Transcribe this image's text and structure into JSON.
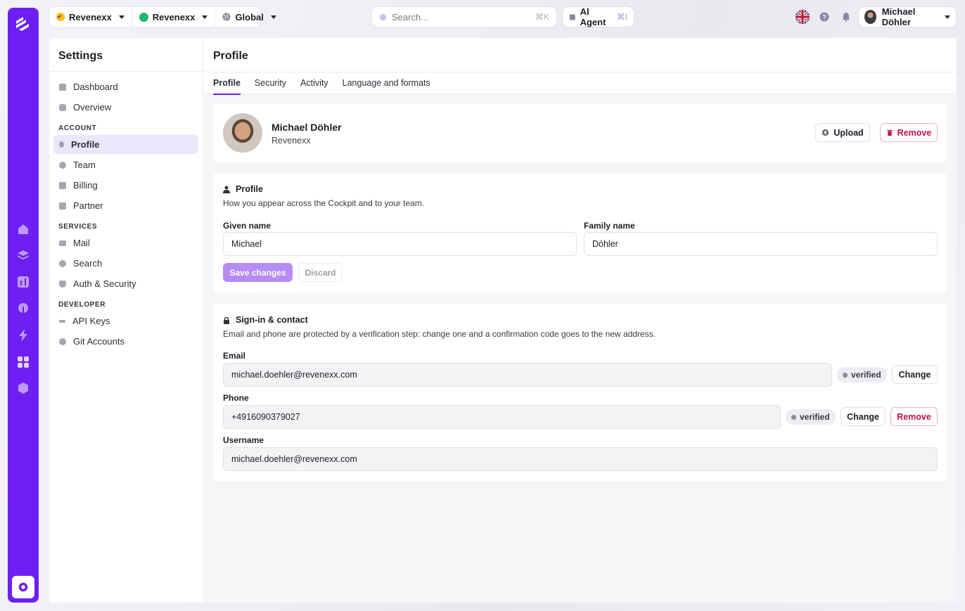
{
  "topbar": {
    "context": [
      {
        "label": "Revenexx",
        "icon": "revenexx-logo-icon"
      },
      {
        "label": "Revenexx",
        "icon": "green-dot-icon"
      },
      {
        "label": "Global",
        "icon": "globe-icon"
      }
    ],
    "search": {
      "placeholder": "Search...",
      "shortcut": "⌘K"
    },
    "agent": {
      "label": "AI Agent",
      "shortcut": "⌘I"
    },
    "user": {
      "name": "Michael Döhler"
    }
  },
  "sidebar": {
    "title": "Settings",
    "top_items": [
      {
        "label": "Dashboard"
      },
      {
        "label": "Overview"
      }
    ],
    "sections": [
      {
        "label": "ACCOUNT",
        "items": [
          {
            "label": "Profile",
            "active": true
          },
          {
            "label": "Team"
          },
          {
            "label": "Billing"
          },
          {
            "label": "Partner"
          }
        ]
      },
      {
        "label": "SERVICES",
        "items": [
          {
            "label": "Mail"
          },
          {
            "label": "Search"
          },
          {
            "label": "Auth & Security"
          }
        ]
      },
      {
        "label": "DEVELOPER",
        "items": [
          {
            "label": "API Keys"
          },
          {
            "label": "Git Accounts"
          }
        ]
      }
    ]
  },
  "main": {
    "title": "Profile",
    "tabs": [
      "Profile",
      "Security",
      "Activity",
      "Language and formats"
    ],
    "header_card": {
      "name": "Michael Döhler",
      "org": "Revenexx",
      "upload_label": "Upload",
      "remove_label": "Remove"
    },
    "profile_section": {
      "title": "Profile",
      "description": "How you appear across the Cockpit and to your team.",
      "given_label": "Given name",
      "given_value": "Michael",
      "family_label": "Family name",
      "family_value": "Döhler",
      "save_label": "Save changes",
      "discard_label": "Discard"
    },
    "signin_section": {
      "title": "Sign-in & contact",
      "description": "Email and phone are protected by a verification step: change one and a confirmation code goes to the new address.",
      "email_label": "Email",
      "email_value": "michael.doehler@revenexx.com",
      "email_badge": "verified",
      "email_change": "Change",
      "phone_label": "Phone",
      "phone_value": "+4916090379027",
      "phone_badge": "verified",
      "phone_change": "Change",
      "phone_remove": "Remove",
      "username_label": "Username",
      "username_value": "michael.doehler@revenexx.com"
    }
  },
  "colors": {
    "brand": "#6d1ff2",
    "danger": "#c4124a",
    "save_disabled": "#b58cf5"
  }
}
